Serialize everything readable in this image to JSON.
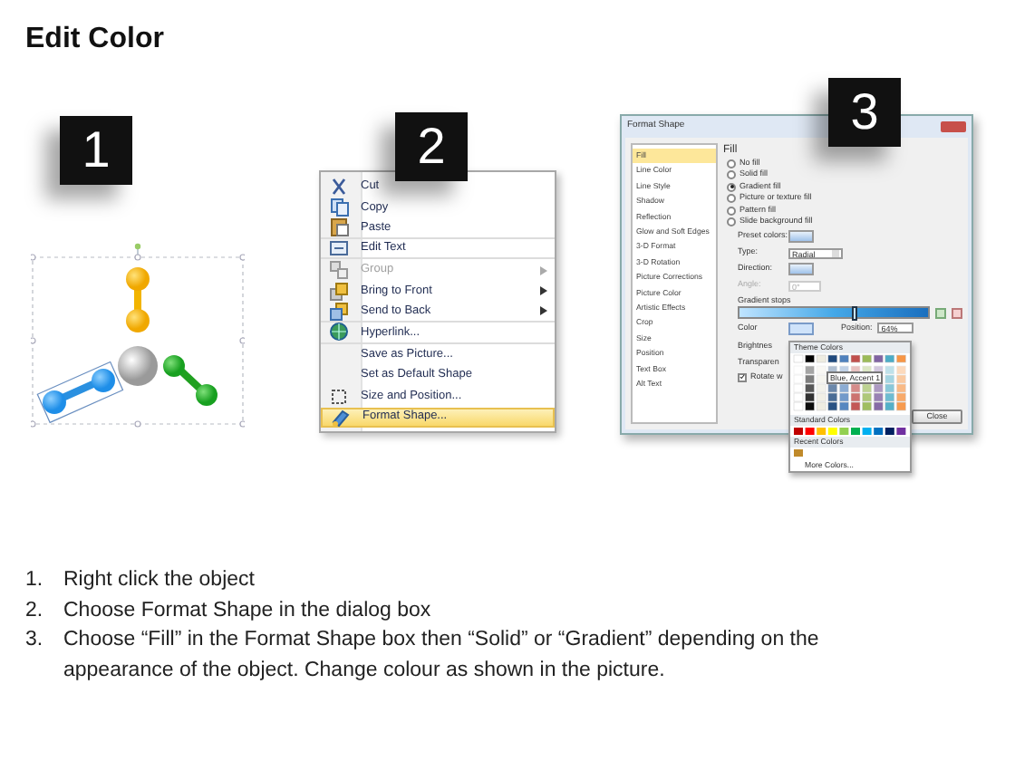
{
  "title": "Edit Color",
  "badges": [
    "1",
    "2",
    "3"
  ],
  "context_menu": [
    {
      "label": "Cut",
      "kind": "scissors",
      "disabled": false,
      "submenu": false,
      "highlighted": false,
      "divider_after": false
    },
    {
      "label": "Copy",
      "kind": "copy",
      "disabled": false,
      "submenu": false,
      "highlighted": false,
      "divider_after": false
    },
    {
      "label": "Paste",
      "kind": "paste",
      "disabled": false,
      "submenu": false,
      "highlighted": false,
      "divider_after": true
    },
    {
      "label": "Edit Text",
      "kind": "text",
      "disabled": false,
      "submenu": false,
      "highlighted": false,
      "divider_after": true
    },
    {
      "label": "Group",
      "kind": "group",
      "disabled": true,
      "submenu": true,
      "highlighted": false,
      "divider_after": false
    },
    {
      "label": "Bring to Front",
      "kind": "front",
      "disabled": false,
      "submenu": true,
      "highlighted": false,
      "divider_after": false
    },
    {
      "label": "Send to Back",
      "kind": "back",
      "disabled": false,
      "submenu": true,
      "highlighted": false,
      "divider_after": true
    },
    {
      "label": "Hyperlink...",
      "kind": "globe",
      "disabled": false,
      "submenu": false,
      "highlighted": false,
      "divider_after": true
    },
    {
      "label": "Save as Picture...",
      "kind": "plain",
      "disabled": false,
      "submenu": false,
      "highlighted": false,
      "divider_after": false
    },
    {
      "label": "Set as Default Shape",
      "kind": "plain",
      "disabled": false,
      "submenu": false,
      "highlighted": false,
      "divider_after": false
    },
    {
      "label": "Size and Position...",
      "kind": "size",
      "disabled": false,
      "submenu": false,
      "highlighted": false,
      "divider_after": false
    },
    {
      "label": "Format Shape...",
      "kind": "format",
      "disabled": false,
      "submenu": false,
      "highlighted": true,
      "divider_after": false
    }
  ],
  "dialog": {
    "title": "Format Shape",
    "categories": [
      {
        "label": "Fill",
        "selected": true
      },
      {
        "label": "Line Color",
        "selected": false
      },
      {
        "label": "Line Style",
        "selected": false
      },
      {
        "label": "Shadow",
        "selected": false
      },
      {
        "label": "Reflection",
        "selected": false
      },
      {
        "label": "Glow and Soft Edges",
        "selected": false
      },
      {
        "label": "3-D Format",
        "selected": false
      },
      {
        "label": "3-D Rotation",
        "selected": false
      },
      {
        "label": "Picture Corrections",
        "selected": false
      },
      {
        "label": "Picture Color",
        "selected": false
      },
      {
        "label": "Artistic Effects",
        "selected": false
      },
      {
        "label": "Crop",
        "selected": false
      },
      {
        "label": "Size",
        "selected": false
      },
      {
        "label": "Position",
        "selected": false
      },
      {
        "label": "Text Box",
        "selected": false
      },
      {
        "label": "Alt Text",
        "selected": false
      }
    ],
    "section": "Fill",
    "fill_options": [
      {
        "label": "No fill",
        "selected": false
      },
      {
        "label": "Solid fill",
        "selected": false
      },
      {
        "label": "Gradient fill",
        "selected": true
      },
      {
        "label": "Picture or texture fill",
        "selected": false
      },
      {
        "label": "Pattern fill",
        "selected": false
      },
      {
        "label": "Slide background fill",
        "selected": false
      }
    ],
    "fields": [
      {
        "label": "Preset colors:",
        "kind": "swatch",
        "disabled": false
      },
      {
        "label": "Type:",
        "kind": "dropdown",
        "value": "Radial",
        "disabled": false
      },
      {
        "label": "Direction:",
        "kind": "swatch",
        "disabled": false
      },
      {
        "label": "Angle:",
        "kind": "spin",
        "value": "0°",
        "disabled": true
      }
    ],
    "gradient_stops_label": "Gradient stops",
    "color_label": "Color",
    "position_label": "Position:",
    "position_value": "64%",
    "brightness_label": "Brightnes",
    "transparency_label": "Transparen",
    "rotate": {
      "label": "Rotate w",
      "checked": true
    },
    "close_button": "Close",
    "color_popup": {
      "theme_heading": "Theme Colors",
      "tooltip": "Blue, Accent 1",
      "standard_heading": "Standard Colors",
      "recent_heading": "Recent Colors",
      "more_colors": "More Colors..."
    }
  },
  "steps": [
    {
      "number": "1.",
      "text": "Right click the object"
    },
    {
      "number": "2.",
      "text": "Choose Format Shape in the dialog box"
    },
    {
      "number": "3.",
      "text": "Choose “Fill” in the Format Shape box then “Solid” or “Gradient” depending on the appearance of the object. Change colour as shown in the picture."
    }
  ]
}
